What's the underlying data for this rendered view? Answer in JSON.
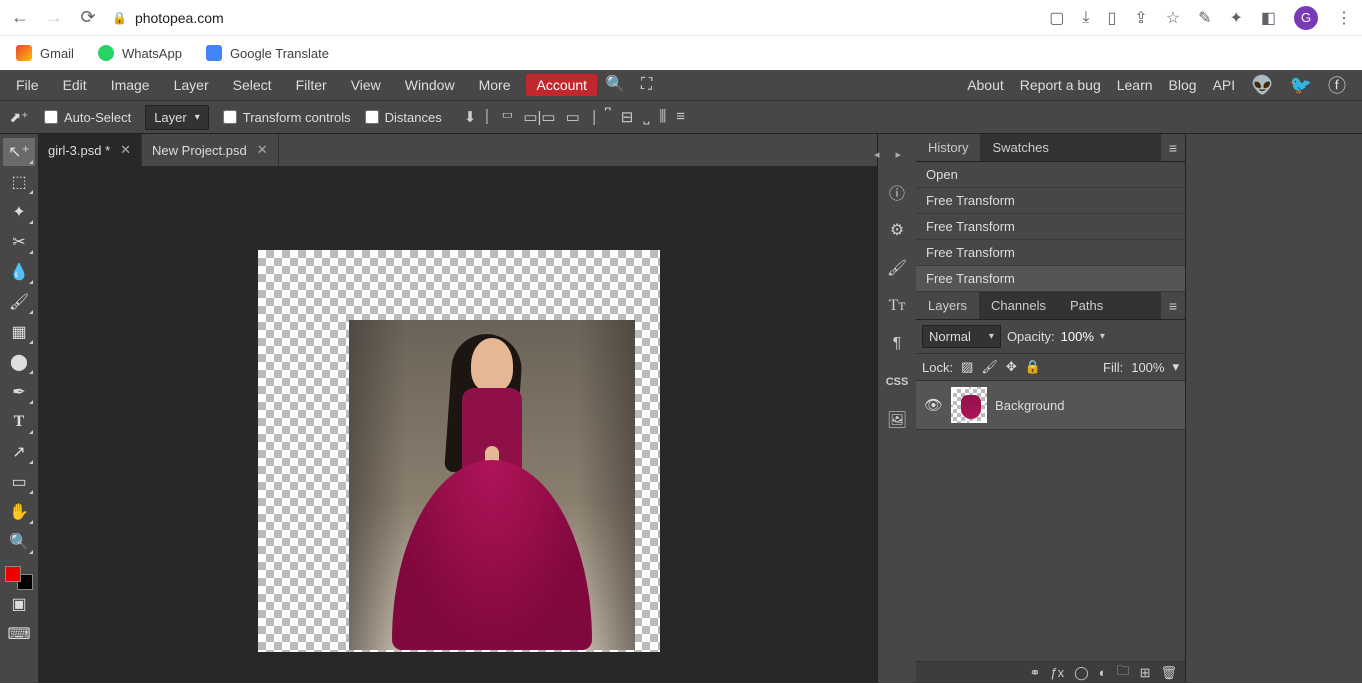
{
  "browser": {
    "url": "photopea.com",
    "profile_initial": "G",
    "bookmarks": [
      {
        "label": "Gmail"
      },
      {
        "label": "WhatsApp"
      },
      {
        "label": "Google Translate"
      }
    ]
  },
  "menu": {
    "items": [
      "File",
      "Edit",
      "Image",
      "Layer",
      "Select",
      "Filter",
      "View",
      "Window",
      "More"
    ],
    "account": "Account",
    "right": [
      "About",
      "Report a bug",
      "Learn",
      "Blog",
      "API"
    ]
  },
  "options": {
    "auto_select": "Auto-Select",
    "target": "Layer",
    "transform_controls": "Transform controls",
    "distances": "Distances"
  },
  "tabs": [
    {
      "label": "girl-3.psd *",
      "active": true
    },
    {
      "label": "New Project.psd",
      "active": false
    }
  ],
  "panels": {
    "history": {
      "tabs": [
        "History",
        "Swatches"
      ],
      "items": [
        "Open",
        "Free Transform",
        "Free Transform",
        "Free Transform",
        "Free Transform"
      ]
    },
    "layers": {
      "tabs": [
        "Layers",
        "Channels",
        "Paths"
      ],
      "blend_mode": "Normal",
      "opacity_label": "Opacity:",
      "opacity_value": "100%",
      "lock_label": "Lock:",
      "fill_label": "Fill:",
      "fill_value": "100%",
      "layer_name": "Background"
    }
  },
  "colors": {
    "foreground": "#e00000",
    "background": "#000000"
  }
}
